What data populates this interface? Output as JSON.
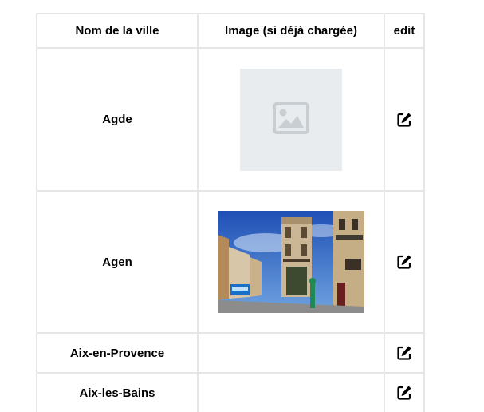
{
  "table": {
    "headers": {
      "city": "Nom de la ville",
      "image": "Image (si déjà chargée)",
      "edit": "edit"
    },
    "rows": [
      {
        "city": "Agde",
        "image": "placeholder",
        "edit_icon": "edit-icon"
      },
      {
        "city": "Agen",
        "image": "photo",
        "edit_icon": "edit-icon"
      },
      {
        "city": "Aix-en-Provence",
        "image": "none",
        "edit_icon": "edit-icon"
      },
      {
        "city": "Aix-les-Bains",
        "image": "none",
        "edit_icon": "edit-icon"
      }
    ]
  },
  "colors": {
    "border": "#e6e6e6",
    "placeholder_bg": "#e8ecef",
    "placeholder_icon": "#c9ced3"
  }
}
